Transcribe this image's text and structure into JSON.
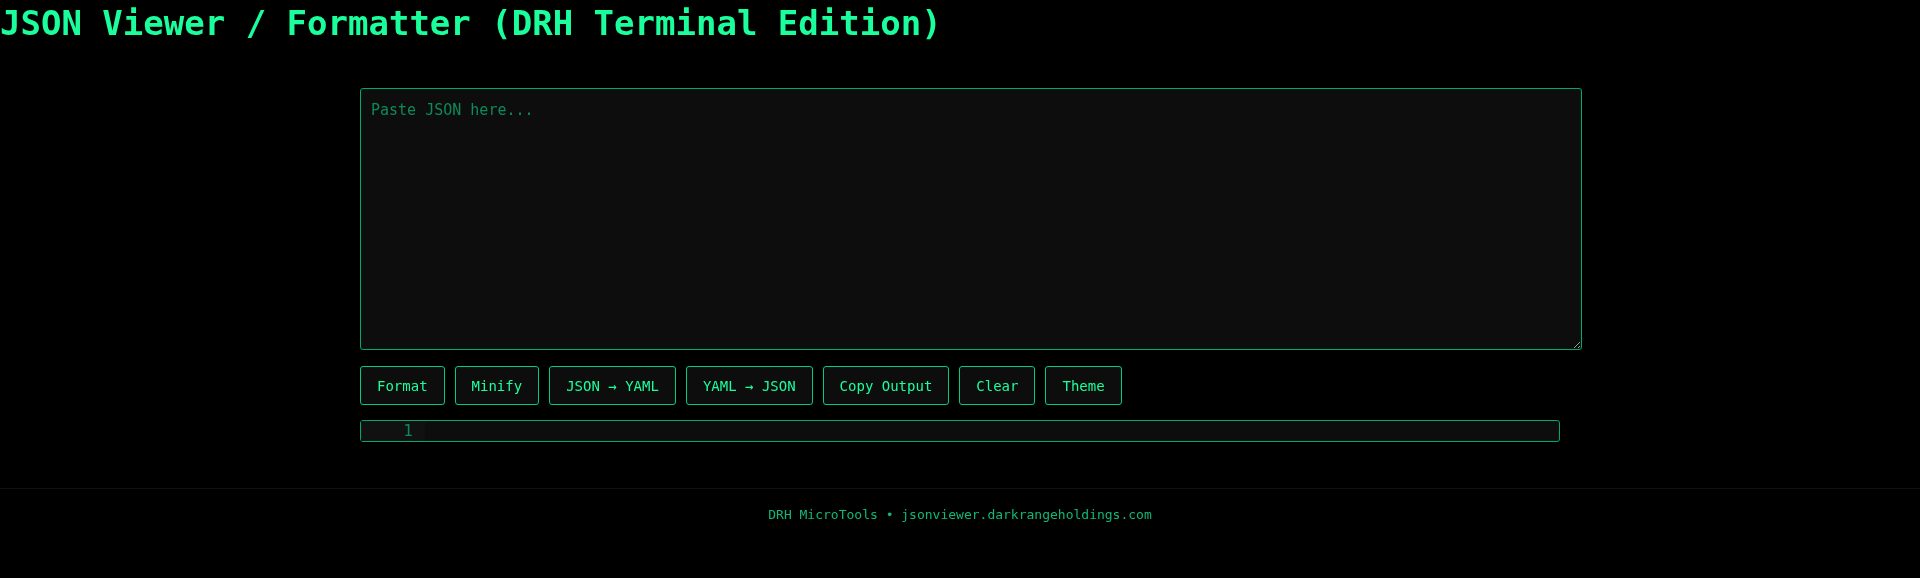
{
  "header": {
    "title": "JSON Viewer / Formatter (DRH Terminal Edition)"
  },
  "editor": {
    "placeholder": "Paste JSON here..."
  },
  "buttons": [
    "Format",
    "Minify",
    "JSON → YAML",
    "YAML → JSON",
    "Copy Output",
    "Clear",
    "Theme"
  ],
  "output": {
    "line_numbers": [
      "1"
    ]
  },
  "footer": {
    "text": "DRH MicroTools • jsonviewer.darkrangeholdings.com"
  }
}
